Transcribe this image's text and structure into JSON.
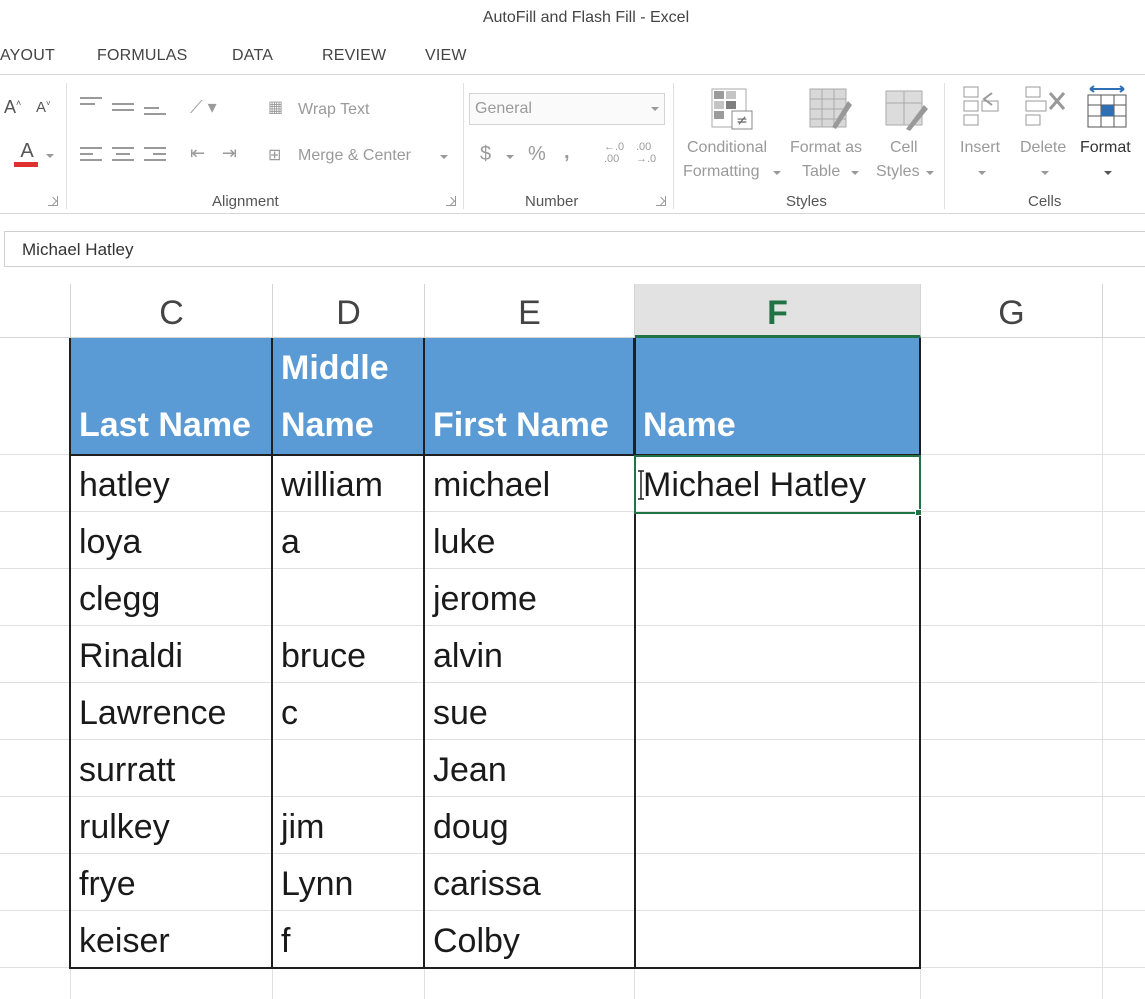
{
  "window": {
    "title": "AutoFill and Flash Fill - Excel"
  },
  "ribbon_tabs": [
    "AYOUT",
    "FORMULAS",
    "DATA",
    "REVIEW",
    "VIEW"
  ],
  "ribbon": {
    "alignment": {
      "wrap_text": "Wrap Text",
      "merge_center": "Merge & Center",
      "label": "Alignment"
    },
    "number": {
      "format": "General",
      "currency": "$",
      "percent": "%",
      "comma": ",",
      "label": "Number"
    },
    "styles": {
      "conditional_formatting": [
        "Conditional",
        "Formatting"
      ],
      "format_as_table": [
        "Format as",
        "Table"
      ],
      "cell_styles": [
        "Cell",
        "Styles"
      ],
      "label": "Styles"
    },
    "cells": {
      "insert": "Insert",
      "delete": "Delete",
      "format": "Format",
      "label": "Cells"
    }
  },
  "formula_bar": {
    "value": "Michael Hatley"
  },
  "columns": [
    "C",
    "D",
    "E",
    "F",
    "G"
  ],
  "table": {
    "headers": [
      {
        "line1": "",
        "line2": "Last Name"
      },
      {
        "line1": "Middle",
        "line2": "Name"
      },
      {
        "line1": "",
        "line2": "First Name"
      },
      {
        "line1": "",
        "line2": "Name"
      }
    ],
    "rows": [
      [
        "hatley",
        "william",
        "michael",
        "Michael Hatley"
      ],
      [
        "loya",
        "a",
        "luke",
        ""
      ],
      [
        "clegg",
        "",
        "jerome",
        ""
      ],
      [
        "Rinaldi",
        "bruce",
        "alvin",
        ""
      ],
      [
        "Lawrence",
        "c",
        "sue",
        ""
      ],
      [
        "surratt",
        "",
        "Jean",
        ""
      ],
      [
        "rulkey",
        "jim",
        "doug",
        ""
      ],
      [
        "frye",
        "Lynn",
        "carissa",
        ""
      ],
      [
        "keiser",
        "f",
        "Colby",
        ""
      ]
    ]
  },
  "colors": {
    "accent": "#217346",
    "table_header": "#5b9bd5"
  }
}
